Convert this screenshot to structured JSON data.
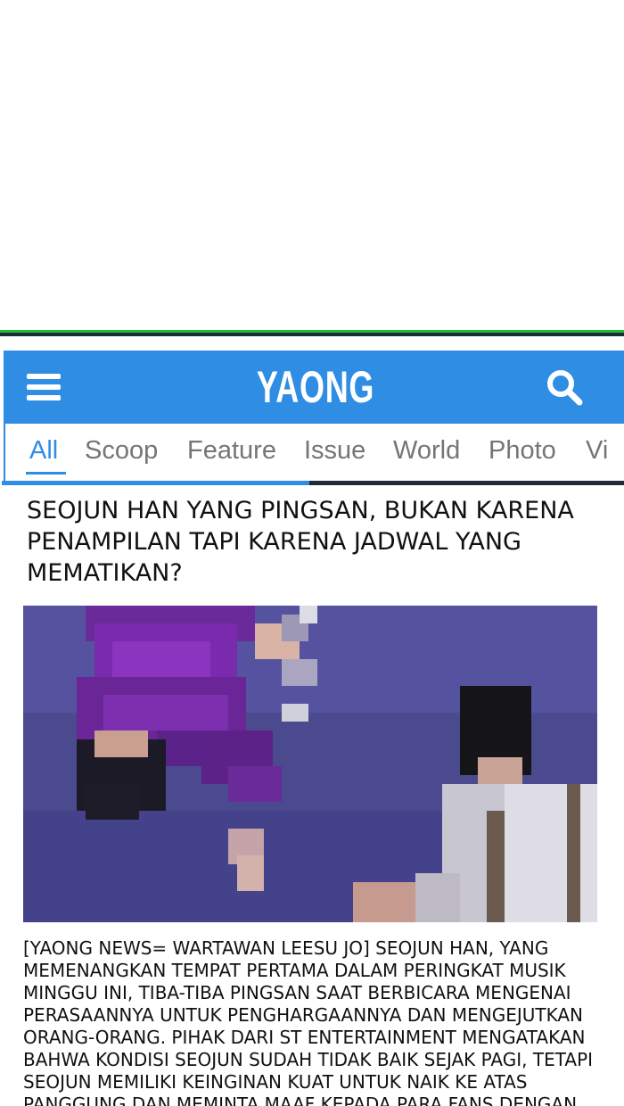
{
  "app": {
    "brand": "YAONG NEWS"
  },
  "header": {
    "menu_icon": "hamburger-menu-icon",
    "search_icon": "search-icon",
    "colors": {
      "bar": "#2f8de4",
      "accent": "#2f8de4"
    }
  },
  "tabs": [
    {
      "label": "All",
      "active": true
    },
    {
      "label": "Scoop",
      "active": false
    },
    {
      "label": "Feature",
      "active": false
    },
    {
      "label": "Issue",
      "active": false
    },
    {
      "label": "World",
      "active": false
    },
    {
      "label": "Photo",
      "active": false
    },
    {
      "label": "Vi",
      "active": false
    }
  ],
  "article": {
    "headline": "SEOJUN HAN YANG PINGSAN, BUKAN KARENA PENAMPILAN TAPI KARENA JADWAL YANG MEMATIKAN?",
    "body": "[YAONG NEWS= WARTAWAN LEESU JO] SEOJUN HAN, YANG MEMENANGKAN TEMPAT PERTAMA DALAM PERINGKAT MUSIK MINGGU INI, TIBA-TIBA PINGSAN SAAT BERBICARA MENGENAI PERASAANNYA UNTUK PENGHARGAANNYA DAN MENGEJUTKAN ORANG-ORANG. PIHAK DARI ST ENTERTAINMENT MENGATAKAN BAHWA KONDISI SEOJUN SUDAH TIDAK BAIK SEJAK PAGI, TETAPI SEOJUN MEMILIKI KEINGINAN KUAT UNTUK NAIK KE ATAS PANGGUNG DAN MEMINTA MAAF KEPADA PARA FANS DENGAN"
  }
}
